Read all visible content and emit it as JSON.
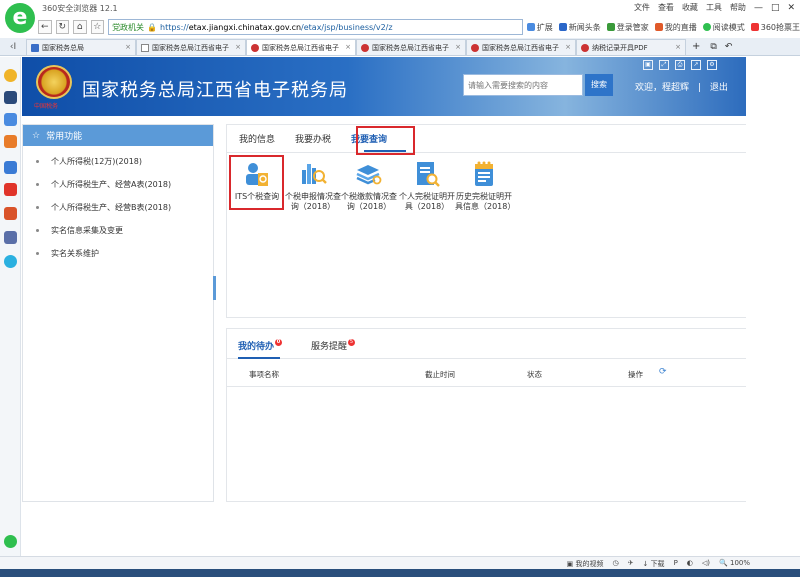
{
  "browser": {
    "app_title": "360安全浏览器 12.1",
    "menu": [
      "文件",
      "查看",
      "收藏",
      "工具",
      "帮助"
    ],
    "address": {
      "security_label": "党政机关",
      "url_prefix": "https://",
      "url_domain": "etax.jiangxi.chinatax.gov.cn",
      "url_path": "/etax/jsp/business/v2/z"
    },
    "bookmarks": [
      "扩展",
      "新闻头条",
      "登录管家",
      "我的直播",
      "阅读模式",
      "360抢票王"
    ],
    "tabs": [
      {
        "label": "国家税务总局",
        "active": false
      },
      {
        "label": "国家税务总局江西省电子",
        "active": false
      },
      {
        "label": "国家税务总局江西省电子",
        "active": true
      },
      {
        "label": "国家税务总局江西省电子",
        "active": false
      },
      {
        "label": "国家税务总局江西省电子",
        "active": false
      },
      {
        "label": "纳税记录开具PDF",
        "active": false
      }
    ],
    "status": [
      "我的视频",
      "下载",
      "100%"
    ]
  },
  "banner": {
    "sub": "中国税务",
    "title": "国家税务总局江西省电子税务局",
    "search_placeholder": "请输入需要搜索的内容",
    "search_button": "搜索",
    "welcome": "欢迎，程超辉",
    "logout": "退出"
  },
  "leftmenu": {
    "header": "常用功能",
    "items": [
      "个人所得税(12万)(2018)",
      "个人所得税生产、经营A表(2018)",
      "个人所得税生产、经营B表(2018)",
      "实名信息采集及变更",
      "实名关系维护"
    ]
  },
  "main": {
    "tabs": [
      "我的信息",
      "我要办税",
      "我要查询"
    ],
    "active_tab": "我要查询",
    "functions": [
      {
        "label": "ITS个税查询",
        "icon": "person-search-icon"
      },
      {
        "label": "个税申报情况查询（2018）",
        "icon": "chart-search-icon"
      },
      {
        "label": "个税缴款情况查询（2018）",
        "icon": "stack-search-icon"
      },
      {
        "label": "个人完税证明开具（2018）",
        "icon": "document-search-icon"
      },
      {
        "label": "历史完税证明开具信息（2018）",
        "icon": "calendar-doc-icon"
      }
    ]
  },
  "todo": {
    "tabs": [
      {
        "label": "我的待办",
        "badge": "0"
      },
      {
        "label": "服务提醒",
        "badge": "5"
      }
    ],
    "columns": [
      "事项名称",
      "截止时间",
      "状态",
      "操作"
    ]
  },
  "colors": {
    "accent": "#1f5fb3",
    "highlight": "#d9282c",
    "menu_header": "#5b9ad8"
  }
}
